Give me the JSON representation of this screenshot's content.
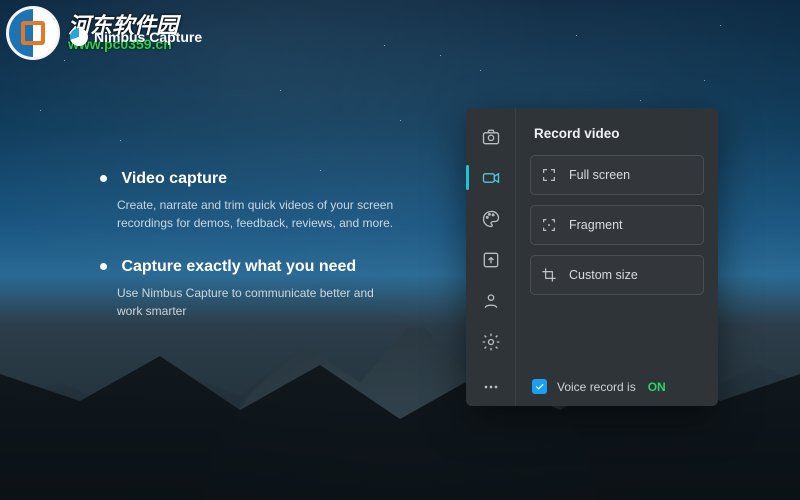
{
  "watermark": {
    "line1": "河东软件园",
    "line2": "www.pc0359.cn"
  },
  "app": {
    "name": "Nimbus Capture"
  },
  "marketing": {
    "items": [
      {
        "title": "Video capture",
        "desc": "Create, narrate and trim quick videos of your screen recordings for demos, feedback, reviews, and more."
      },
      {
        "title": "Capture exactly what you need",
        "desc": "Use Nimbus Capture to communicate better and work smarter"
      }
    ]
  },
  "panel": {
    "header": "Record video",
    "rail": [
      {
        "name": "capture-photo-icon"
      },
      {
        "name": "record-video-icon",
        "active": true
      },
      {
        "name": "palette-icon"
      },
      {
        "name": "upload-icon"
      },
      {
        "name": "account-icon"
      },
      {
        "name": "settings-icon"
      },
      {
        "name": "more-icon"
      }
    ],
    "options": [
      {
        "label": "Full screen",
        "icon": "fullscreen-icon"
      },
      {
        "label": "Fragment",
        "icon": "fragment-icon"
      },
      {
        "label": "Custom size",
        "icon": "crop-icon"
      }
    ],
    "voice": {
      "label_prefix": "Voice record is",
      "state": "ON",
      "checked": true
    }
  },
  "colors": {
    "accent": "#24c3d2",
    "on_green": "#2bd36c",
    "checkbox": "#1aa0ef"
  }
}
